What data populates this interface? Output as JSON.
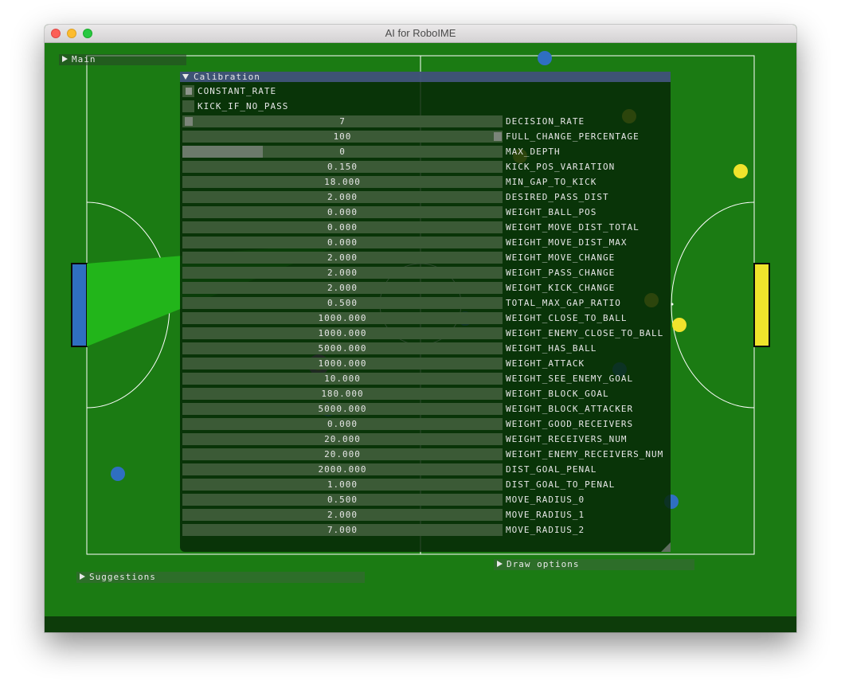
{
  "window": {
    "title": "AI for RoboIME"
  },
  "colors": {
    "field": "#1b7b13",
    "blue_team": "#2f6fc1",
    "yellow_team": "#f0e32c",
    "ball_orange": "#c98a2c",
    "panel_header": "#4a5a8c"
  },
  "menus": {
    "main": "Main",
    "calibration": "Calibration",
    "suggestions": "Suggestions",
    "draw_options": "Draw options"
  },
  "checkboxes": [
    {
      "label": "CONSTANT_RATE",
      "checked": true
    },
    {
      "label": "KICK_IF_NO_PASS",
      "checked": false
    }
  ],
  "sliders": [
    {
      "label": "DECISION_RATE",
      "value": "7",
      "fraction": 0
    },
    {
      "label": "FULL_CHANGE_PERCENTAGE",
      "value": "100",
      "fraction": 1
    },
    {
      "label": "MAX_DEPTH",
      "value": "0",
      "fraction": 0.25
    },
    {
      "label": "KICK_POS_VARIATION",
      "value": "0.150",
      "fraction": 0
    },
    {
      "label": "MIN_GAP_TO_KICK",
      "value": "18.000",
      "fraction": 0
    },
    {
      "label": "DESIRED_PASS_DIST",
      "value": "2.000",
      "fraction": 0
    },
    {
      "label": "WEIGHT_BALL_POS",
      "value": "0.000",
      "fraction": 0
    },
    {
      "label": "WEIGHT_MOVE_DIST_TOTAL",
      "value": "0.000",
      "fraction": 0
    },
    {
      "label": "WEIGHT_MOVE_DIST_MAX",
      "value": "0.000",
      "fraction": 0
    },
    {
      "label": "WEIGHT_MOVE_CHANGE",
      "value": "2.000",
      "fraction": 0
    },
    {
      "label": "WEIGHT_PASS_CHANGE",
      "value": "2.000",
      "fraction": 0
    },
    {
      "label": "WEIGHT_KICK_CHANGE",
      "value": "2.000",
      "fraction": 0
    },
    {
      "label": "TOTAL_MAX_GAP_RATIO",
      "value": "0.500",
      "fraction": 0
    },
    {
      "label": "WEIGHT_CLOSE_TO_BALL",
      "value": "1000.000",
      "fraction": 0
    },
    {
      "label": "WEIGHT_ENEMY_CLOSE_TO_BALL",
      "value": "1000.000",
      "fraction": 0
    },
    {
      "label": "WEIGHT_HAS_BALL",
      "value": "5000.000",
      "fraction": 0
    },
    {
      "label": "WEIGHT_ATTACK",
      "value": "1000.000",
      "fraction": 0
    },
    {
      "label": "WEIGHT_SEE_ENEMY_GOAL",
      "value": "10.000",
      "fraction": 0
    },
    {
      "label": "WEIGHT_BLOCK_GOAL",
      "value": "180.000",
      "fraction": 0
    },
    {
      "label": "WEIGHT_BLOCK_ATTACKER",
      "value": "5000.000",
      "fraction": 0
    },
    {
      "label": "WEIGHT_GOOD_RECEIVERS",
      "value": "0.000",
      "fraction": 0
    },
    {
      "label": "WEIGHT_RECEIVERS_NUM",
      "value": "20.000",
      "fraction": 0
    },
    {
      "label": "WEIGHT_ENEMY_RECEIVERS_NUM",
      "value": "20.000",
      "fraction": 0
    },
    {
      "label": "DIST_GOAL_PENAL",
      "value": "2000.000",
      "fraction": 0
    },
    {
      "label": "DIST_GOAL_TO_PENAL",
      "value": "1.000",
      "fraction": 0
    },
    {
      "label": "MOVE_RADIUS_0",
      "value": "0.500",
      "fraction": 0
    },
    {
      "label": "MOVE_RADIUS_1",
      "value": "2.000",
      "fraction": 0
    },
    {
      "label": "MOVE_RADIUS_2",
      "value": "7.000",
      "fraction": 0
    }
  ]
}
